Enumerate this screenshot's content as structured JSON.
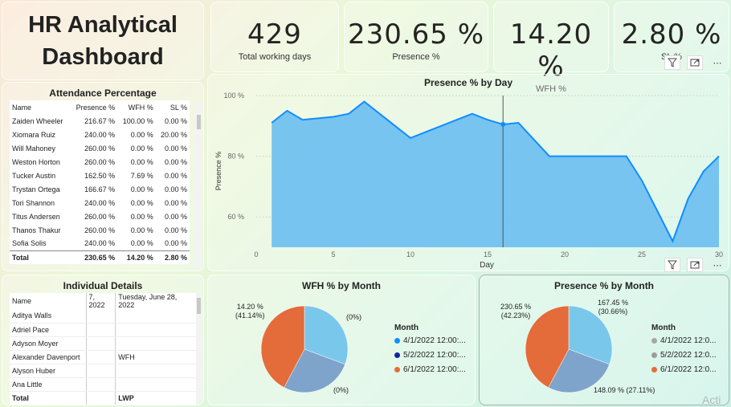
{
  "title": {
    "line1": "HR Analytical",
    "line2": "Dashboard"
  },
  "kpis": [
    {
      "value": "429",
      "label": "Total working days"
    },
    {
      "value": "230.65 %",
      "label": "Presence %"
    },
    {
      "value": "14.20 %",
      "label": "WFH %"
    },
    {
      "value": "2.80 %",
      "label": "SL %"
    }
  ],
  "attendance": {
    "title": "Attendance Percentage",
    "columns": [
      "Name",
      "Presence %",
      "WFH %",
      "SL %"
    ],
    "rows": [
      [
        "Zaiden Wheeler",
        "216.67 %",
        "100.00 %",
        "0.00 %"
      ],
      [
        "Xiomara Ruiz",
        "240.00 %",
        "0.00 %",
        "20.00 %"
      ],
      [
        "Will Mahoney",
        "260.00 %",
        "0.00 %",
        "0.00 %"
      ],
      [
        "Weston Horton",
        "260.00 %",
        "0.00 %",
        "0.00 %"
      ],
      [
        "Tucker Austin",
        "162.50 %",
        "7.69 %",
        "0.00 %"
      ],
      [
        "Trystan Ortega",
        "166.67 %",
        "0.00 %",
        "0.00 %"
      ],
      [
        "Tori Shannon",
        "240.00 %",
        "0.00 %",
        "0.00 %"
      ],
      [
        "Titus Andersen",
        "260.00 %",
        "0.00 %",
        "0.00 %"
      ],
      [
        "Thanos Thakur",
        "260.00 %",
        "0.00 %",
        "0.00 %"
      ],
      [
        "Sofia Solis",
        "240.00 %",
        "0.00 %",
        "0.00 %"
      ]
    ],
    "total": [
      "Total",
      "230.65 %",
      "14.20 %",
      "2.80 %"
    ]
  },
  "individual": {
    "title": "Individual Details",
    "columns": [
      "Name",
      "7, 2022",
      "Tuesday, June 28, 2022"
    ],
    "rows": [
      [
        "Aditya Walls",
        "",
        ""
      ],
      [
        "Adriel Pace",
        "",
        ""
      ],
      [
        "Adyson Moyer",
        "",
        ""
      ],
      [
        "Alexander Davenport",
        "",
        "WFH"
      ],
      [
        "Alyson Huber",
        "",
        ""
      ],
      [
        "Ana Little",
        "",
        ""
      ]
    ],
    "total": [
      "Total",
      "",
      "LWP"
    ]
  },
  "chart_data": [
    {
      "type": "area",
      "title": "Presence % by Day",
      "xlabel": "Day",
      "ylabel": "Presence %",
      "xlim": [
        0,
        30
      ],
      "ylim": [
        50,
        100
      ],
      "xticks": [
        "0",
        "5",
        "10",
        "15",
        "20",
        "25",
        "30"
      ],
      "yticks": [
        "60 %",
        "80 %",
        "100 %"
      ],
      "x": [
        1,
        2,
        3,
        4,
        5,
        6,
        7,
        8,
        9,
        10,
        11,
        12,
        13,
        14,
        15,
        16,
        17,
        18,
        19,
        20,
        21,
        22,
        23,
        24,
        25,
        26,
        27,
        28,
        29,
        30
      ],
      "values": [
        91,
        95,
        92,
        92.5,
        93,
        94,
        98,
        94,
        90,
        86,
        88,
        90,
        92,
        94,
        92,
        90.5,
        91,
        85.5,
        80,
        80,
        80,
        80,
        80,
        80,
        72,
        62,
        52,
        66,
        75,
        80
      ],
      "color": "#118dff",
      "fill": "#70c1ef"
    },
    {
      "type": "pie",
      "title": "WFH % by Month",
      "legend_title": "Month",
      "categories": [
        "4/1/2022 12:00:...",
        "5/2/2022 12:00:...",
        "6/1/2022 12:00:..."
      ],
      "values": [
        0.001,
        0.001,
        14.2
      ],
      "labels": [
        "(0%)",
        "(0%)",
        "14.20 %\n(41.14%)"
      ]
    },
    {
      "type": "pie",
      "title": "Presence % by Month",
      "legend_title": "Month",
      "categories": [
        "4/1/2022 12:0...",
        "5/2/2022 12:0...",
        "6/1/2022 12:0..."
      ],
      "values": [
        167.45,
        148.09,
        230.65
      ],
      "labels": [
        "167.45 %\n(30.66%)",
        "148.09 % (27.11%)",
        "230.65 %\n(42.23%)"
      ]
    }
  ],
  "colors": {
    "sky": "#79c8ec",
    "steel": "#7fa4cb",
    "orange": "#e46b3a",
    "line": "#118dff",
    "legend_blue": "#118dff",
    "legend_navy": "#12239e",
    "legend_grey": "#a6a6a6",
    "legend_grey2": "#9b9b9b"
  },
  "icons": {
    "filter": "filter-icon",
    "focus": "focus-mode-icon",
    "more": "more-options-icon"
  },
  "watermark": "Acti"
}
